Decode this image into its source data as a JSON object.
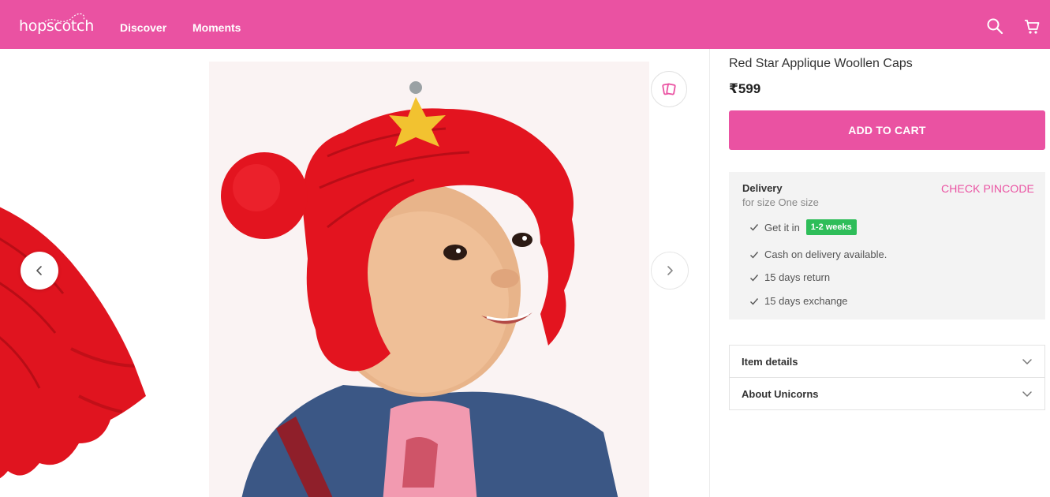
{
  "header": {
    "logo": "hopscotch",
    "nav": [
      "Discover",
      "Moments"
    ],
    "icons": [
      "search-icon",
      "cart-icon"
    ]
  },
  "gallery": {
    "icons": [
      "chevron-left-icon",
      "chevron-right-icon",
      "wishlist-icon"
    ]
  },
  "product": {
    "title": "Red Star Applique Woollen Caps",
    "price": "₹599",
    "add_to_cart": "ADD TO CART"
  },
  "delivery": {
    "title": "Delivery",
    "subtitle": "for size One size",
    "check_pincode": "CHECK PINCODE",
    "get_it_in": "Get it in",
    "eta_badge": "1-2 weeks",
    "features": [
      "Cash on delivery available.",
      "15 days return",
      "15 days exchange"
    ]
  },
  "accordions": [
    "Item details",
    "About Unicorns"
  ],
  "colors": {
    "brand": "#ea52a2",
    "badge_green": "#2ebd59",
    "panel_bg": "#f3f3f3"
  }
}
